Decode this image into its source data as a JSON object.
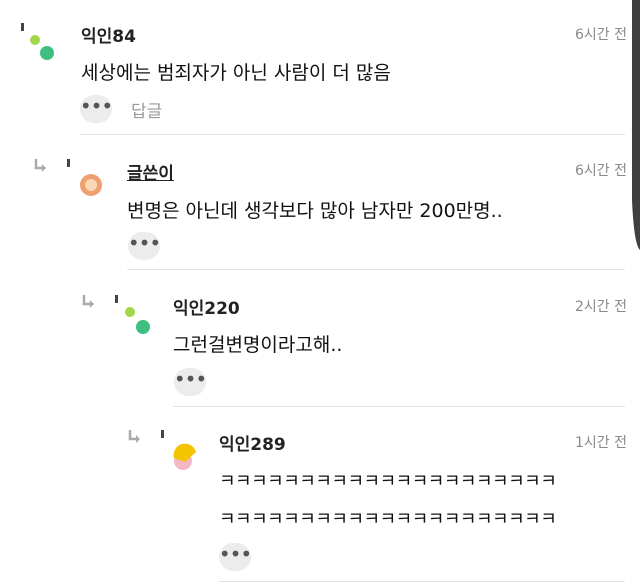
{
  "comments": [
    {
      "user": "익인84",
      "time": "6시간 전",
      "lines": [
        "세상에는 범죄자가 아닌 사람이 더 많음"
      ],
      "reply_label": "답글"
    },
    {
      "user": "글쓴이",
      "time": "6시간 전",
      "lines": [
        "변명은 아닌데 생각보다 많아 남자만 200만명.."
      ]
    },
    {
      "user": "익인220",
      "time": "2시간 전",
      "lines": [
        "그런걸변명이라고해.."
      ]
    },
    {
      "user": "익인289",
      "time": "1시간 전",
      "lines": [
        "ㅋㅋㅋㅋㅋㅋㅋㅋㅋㅋㅋㅋㅋㅋㅋㅋㅋㅋㅋㅋㅋ",
        "ㅋㅋㅋㅋㅋㅋㅋㅋㅋㅋㅋㅋㅋㅋㅋㅋㅋㅋㅋㅋㅋ"
      ]
    }
  ],
  "icons": {
    "more": "more-dots-icon",
    "reply_arrow": "reply-arrow-icon"
  },
  "colors": {
    "green_light": "#9fd84a",
    "green": "#3fbf7f",
    "orange": "#f0a070",
    "yellow": "#f5c400",
    "pink": "#f2b8c6"
  }
}
